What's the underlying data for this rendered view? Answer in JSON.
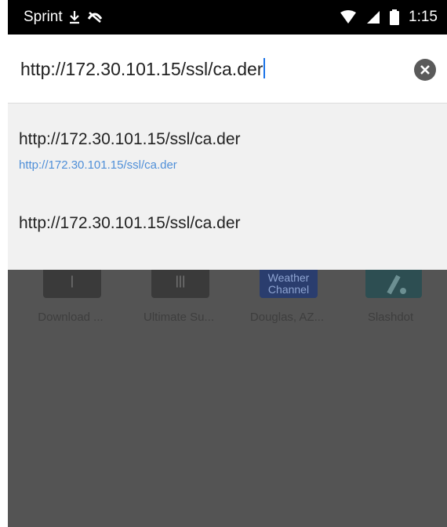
{
  "status_bar": {
    "carrier": "Sprint",
    "time": "1:15",
    "icons": [
      "download-icon",
      "no-sync-icon",
      "wifi-icon",
      "signal-icon",
      "battery-icon"
    ]
  },
  "omnibox": {
    "value": "http://172.30.101.15/ssl/ca.der",
    "clear_icon": "clear-circle-icon"
  },
  "suggestions": [
    {
      "title": "http://172.30.101.15/ssl/ca.der",
      "url": "http://172.30.101.15/ssl/ca.der"
    },
    {
      "title": "http://172.30.101.15/ssl/ca.der"
    }
  ],
  "most_visited": [
    {
      "label": "Download ..."
    },
    {
      "label": "Ultimate Su..."
    },
    {
      "label": "Douglas, AZ...",
      "thumb_text": "Weather Channel"
    },
    {
      "label": "Slashdot"
    }
  ],
  "colors": {
    "suggestion_url": "#4f8fd8",
    "caret": "#1a73e8",
    "backdrop": "#545454"
  }
}
